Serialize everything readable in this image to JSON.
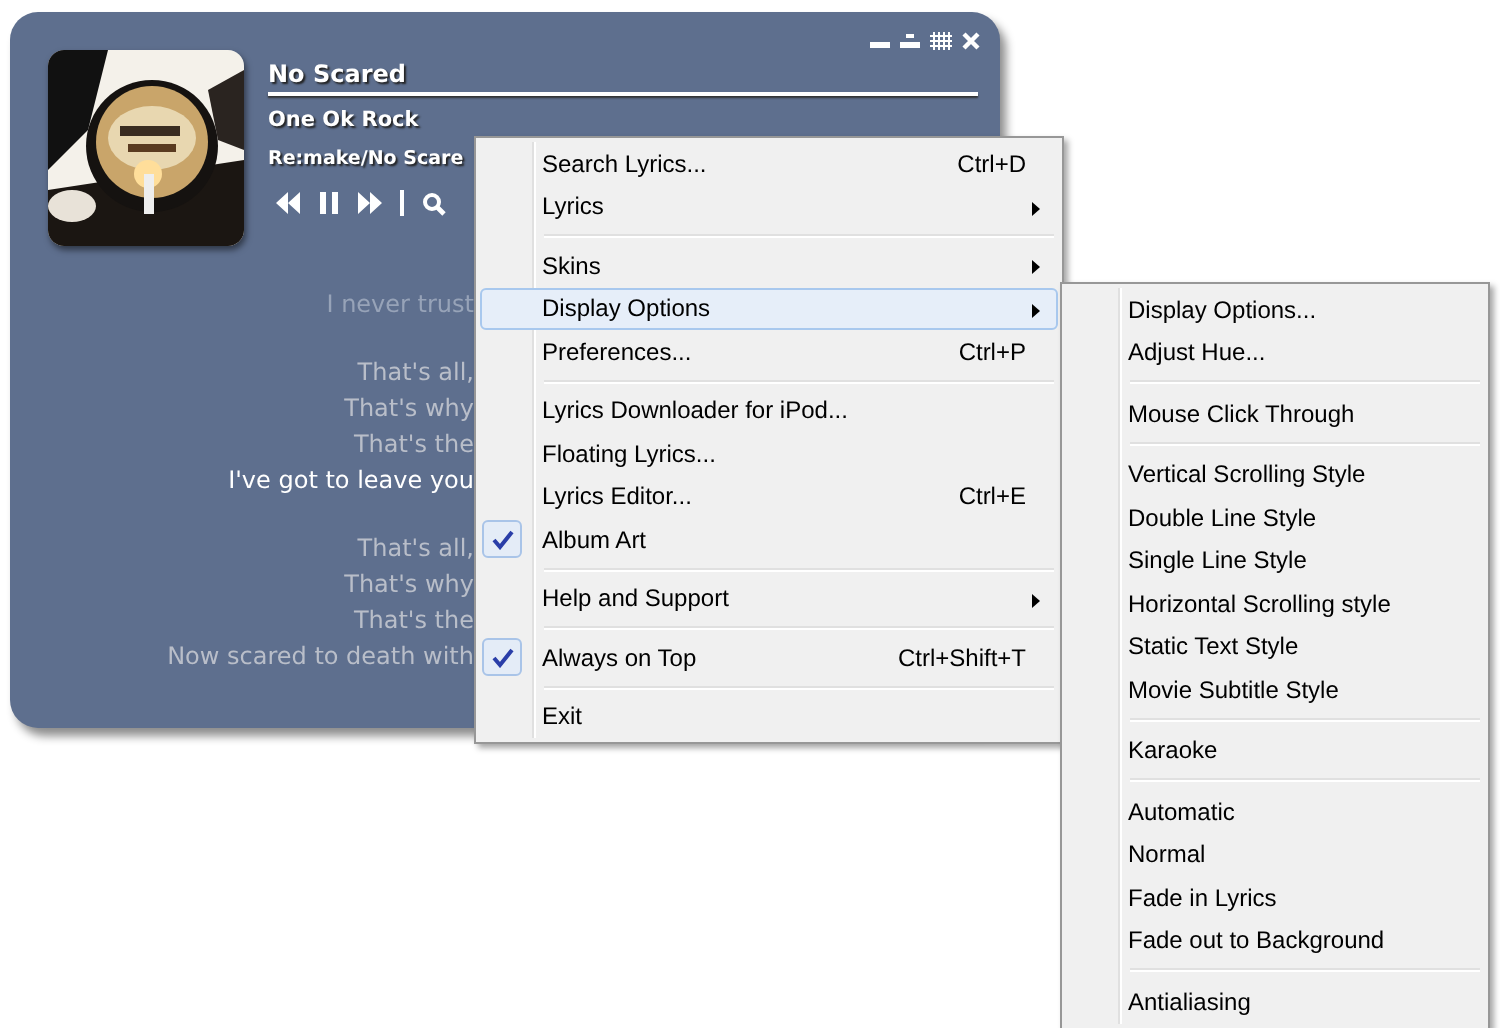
{
  "player": {
    "title": "No Scared",
    "artist": "One Ok Rock",
    "album": "Re:make/No Scare",
    "lyrics": [
      {
        "kind": "dim",
        "text": "I never trust"
      },
      {
        "kind": "gap"
      },
      {
        "kind": "normal",
        "text": "That's all,"
      },
      {
        "kind": "normal",
        "text": "That's why"
      },
      {
        "kind": "normal",
        "text": "That's the"
      },
      {
        "kind": "current",
        "text": "I've got to leave you"
      },
      {
        "kind": "gap"
      },
      {
        "kind": "normal",
        "text": "That's all,"
      },
      {
        "kind": "normal",
        "text": "That's why"
      },
      {
        "kind": "normal",
        "text": "That's the"
      },
      {
        "kind": "normal",
        "text": "Now scared to death with"
      }
    ]
  },
  "menu": [
    {
      "kind": "item",
      "label": "Search Lyrics...",
      "shortcut": "Ctrl+D",
      "submenu": false,
      "checked": false,
      "selected": false
    },
    {
      "kind": "item",
      "label": "Lyrics",
      "submenu": true,
      "checked": false,
      "selected": false
    },
    {
      "kind": "separator"
    },
    {
      "kind": "item",
      "label": "Skins",
      "submenu": true,
      "checked": false,
      "selected": false
    },
    {
      "kind": "item",
      "label": "Display Options",
      "submenu": true,
      "checked": false,
      "selected": true
    },
    {
      "kind": "item",
      "label": "Preferences...",
      "shortcut": "Ctrl+P",
      "submenu": false,
      "checked": false,
      "selected": false
    },
    {
      "kind": "separator"
    },
    {
      "kind": "item",
      "label": "Lyrics Downloader for iPod...",
      "submenu": false,
      "checked": false,
      "selected": false
    },
    {
      "kind": "item",
      "label": "Floating Lyrics...",
      "submenu": false,
      "checked": false,
      "selected": false
    },
    {
      "kind": "item",
      "label": "Lyrics Editor...",
      "shortcut": "Ctrl+E",
      "submenu": false,
      "checked": false,
      "selected": false
    },
    {
      "kind": "item",
      "label": "Album Art",
      "submenu": false,
      "checked": true,
      "selected": false
    },
    {
      "kind": "separator"
    },
    {
      "kind": "item",
      "label": "Help and Support",
      "submenu": true,
      "checked": false,
      "selected": false
    },
    {
      "kind": "separator"
    },
    {
      "kind": "item",
      "label": "Always on Top",
      "shortcut": "Ctrl+Shift+T",
      "submenu": false,
      "checked": true,
      "selected": false
    },
    {
      "kind": "separator"
    },
    {
      "kind": "item",
      "label": "Exit",
      "submenu": false,
      "checked": false,
      "selected": false
    }
  ],
  "submenu": [
    {
      "kind": "item",
      "label": "Display Options..."
    },
    {
      "kind": "item",
      "label": "Adjust Hue..."
    },
    {
      "kind": "separator"
    },
    {
      "kind": "item",
      "label": "Mouse Click Through"
    },
    {
      "kind": "separator"
    },
    {
      "kind": "item",
      "label": "Vertical Scrolling Style"
    },
    {
      "kind": "item",
      "label": "Double Line Style"
    },
    {
      "kind": "item",
      "label": "Single Line Style"
    },
    {
      "kind": "item",
      "label": "Horizontal Scrolling style"
    },
    {
      "kind": "item",
      "label": "Static Text Style"
    },
    {
      "kind": "item",
      "label": "Movie Subtitle Style"
    },
    {
      "kind": "separator"
    },
    {
      "kind": "item",
      "label": "Karaoke"
    },
    {
      "kind": "separator"
    },
    {
      "kind": "item",
      "label": "Automatic"
    },
    {
      "kind": "item",
      "label": "Normal"
    },
    {
      "kind": "item",
      "label": "Fade in Lyrics"
    },
    {
      "kind": "item",
      "label": "Fade out to Background"
    },
    {
      "kind": "separator"
    },
    {
      "kind": "item",
      "label": "Antialiasing"
    }
  ]
}
